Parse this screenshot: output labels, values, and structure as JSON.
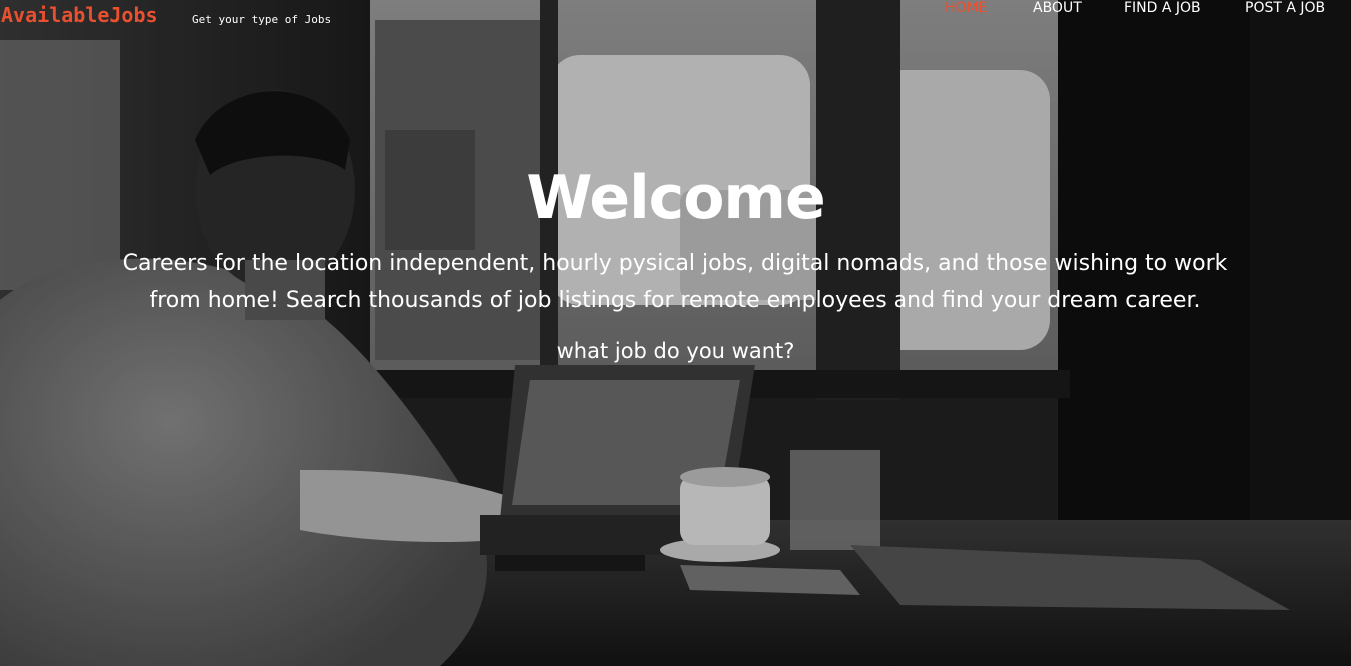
{
  "header": {
    "brand": "AvailableJobs",
    "tagline": "Get your type of Jobs"
  },
  "nav": {
    "items": [
      {
        "label": "HOME",
        "active": true
      },
      {
        "label": "ABOUT",
        "active": false
      },
      {
        "label": "FIND A JOB",
        "active": false
      },
      {
        "label": "POST A JOB",
        "active": false
      }
    ]
  },
  "hero": {
    "title": "Welcome",
    "subtitle": "Careers for the location independent, hourly pysical jobs, digital nomads, and those wishing to work from home! Search thousands of job listings for remote employees and find your dream career.",
    "prompt": "what job do you want?"
  },
  "colors": {
    "accent": "#e8502f",
    "text": "#ffffff"
  }
}
